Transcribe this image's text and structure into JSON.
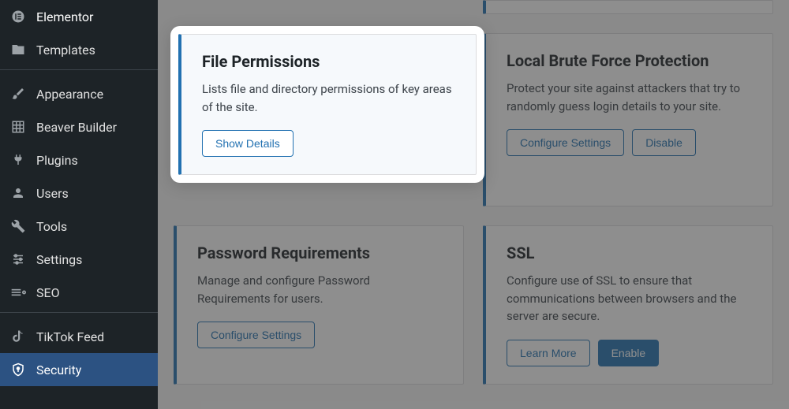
{
  "sidebar": {
    "items": [
      {
        "label": "Elementor"
      },
      {
        "label": "Templates"
      },
      {
        "label": "Appearance"
      },
      {
        "label": "Beaver Builder"
      },
      {
        "label": "Plugins"
      },
      {
        "label": "Users"
      },
      {
        "label": "Tools"
      },
      {
        "label": "Settings"
      },
      {
        "label": "SEO"
      },
      {
        "label": "TikTok Feed"
      },
      {
        "label": "Security"
      }
    ]
  },
  "cards": {
    "file_permissions": {
      "title": "File Permissions",
      "desc": "Lists file and directory permissions of key areas of the site.",
      "button": "Show Details"
    },
    "brute_force": {
      "title": "Local Brute Force Protection",
      "desc": "Protect your site against attackers that try to randomly guess login details to your site.",
      "configure": "Configure Settings",
      "disable": "Disable"
    },
    "password_req": {
      "title": "Password Requirements",
      "desc": "Manage and configure Password Requirements for users.",
      "configure": "Configure Settings"
    },
    "ssl": {
      "title": "SSL",
      "desc": "Configure use of SSL to ensure that communications between browsers and the server are secure.",
      "learn": "Learn More",
      "enable": "Enable"
    }
  }
}
